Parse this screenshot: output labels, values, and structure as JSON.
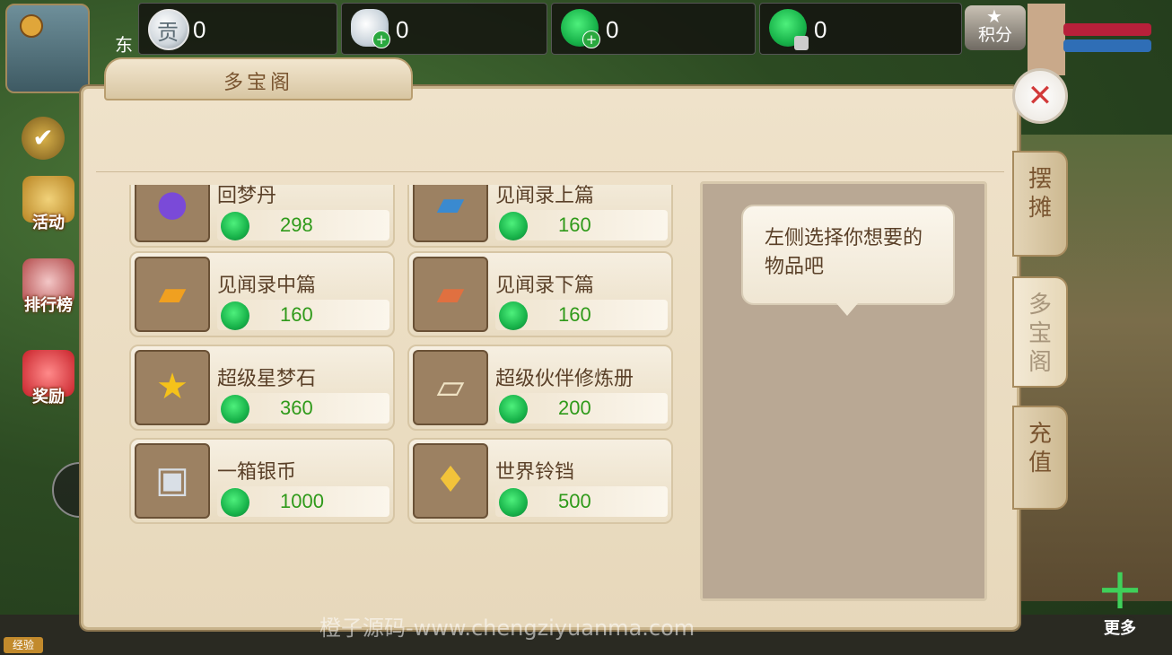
{
  "top_bar": {
    "location_text": "东",
    "currencies": [
      {
        "name": "gong",
        "icon": "contribution-coin-icon",
        "glyph": "贡",
        "value": "0"
      },
      {
        "name": "silver",
        "icon": "silver-ingot-plus-icon",
        "value": "0"
      },
      {
        "name": "jade",
        "icon": "jade-plus-icon",
        "value": "0"
      },
      {
        "name": "bound-jade",
        "icon": "jade-lock-icon",
        "value": "0"
      }
    ],
    "points_label": "积分"
  },
  "side_buttons": [
    {
      "label": "活动",
      "icon": "horn-icon"
    },
    {
      "label": "排行榜",
      "icon": "ranking-icon"
    },
    {
      "label": "奖励",
      "icon": "gift-icon"
    }
  ],
  "panel": {
    "title": "多宝阁",
    "close_glyph": "✕",
    "hint": "左侧选择你想要的物品吧"
  },
  "tabs": [
    {
      "label": "摆摊",
      "active": false
    },
    {
      "label": "多宝阁",
      "active": true
    },
    {
      "label": "充值",
      "active": false
    }
  ],
  "items": [
    {
      "name": "回梦丹",
      "price": "298",
      "icon": "purple-orb-icon"
    },
    {
      "name": "见闻录上篇",
      "price": "160",
      "icon": "blue-book-icon"
    },
    {
      "name": "见闻录中篇",
      "price": "160",
      "icon": "orange-book-icon"
    },
    {
      "name": "见闻录下篇",
      "price": "160",
      "icon": "red-book-icon"
    },
    {
      "name": "超级星梦石",
      "price": "360",
      "icon": "star-stone-icon"
    },
    {
      "name": "超级伙伴修炼册",
      "price": "200",
      "icon": "scroll-icon"
    },
    {
      "name": "一箱银币",
      "price": "1000",
      "icon": "silver-chest-icon"
    },
    {
      "name": "世界铃铛",
      "price": "500",
      "icon": "golden-bell-icon"
    }
  ],
  "bottom": {
    "exp_label": "经验",
    "watermark": "橙子源码-www.chengziyuanma.com",
    "more_label": "更多"
  }
}
